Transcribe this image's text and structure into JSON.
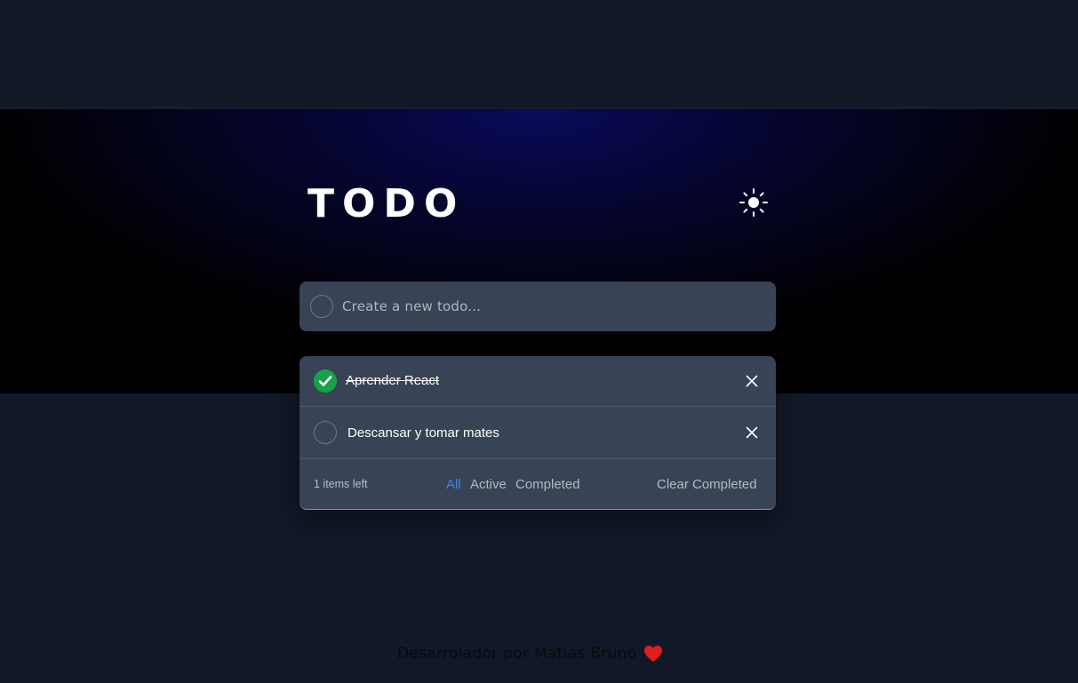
{
  "header": {
    "title": "TODO",
    "theme_icon": "sun-icon"
  },
  "new_todo": {
    "placeholder": "Create a new todo..."
  },
  "todos": [
    {
      "text": "Aprender React",
      "completed": true
    },
    {
      "text": "Descansar y tomar mates",
      "completed": false
    }
  ],
  "footer": {
    "items_left": "1 items left",
    "filters": [
      {
        "label": "All",
        "active": true
      },
      {
        "label": "Active",
        "active": false
      },
      {
        "label": "Completed",
        "active": false
      }
    ],
    "clear_label": "Clear Completed"
  },
  "credit": {
    "text": "Desarrolador por Matias Bruno",
    "icon": "heart-icon"
  },
  "colors": {
    "accent": "#3b82f6",
    "check": "#16a34a",
    "heart": "#e11d1d",
    "card": "#384455",
    "background": "#111827"
  }
}
